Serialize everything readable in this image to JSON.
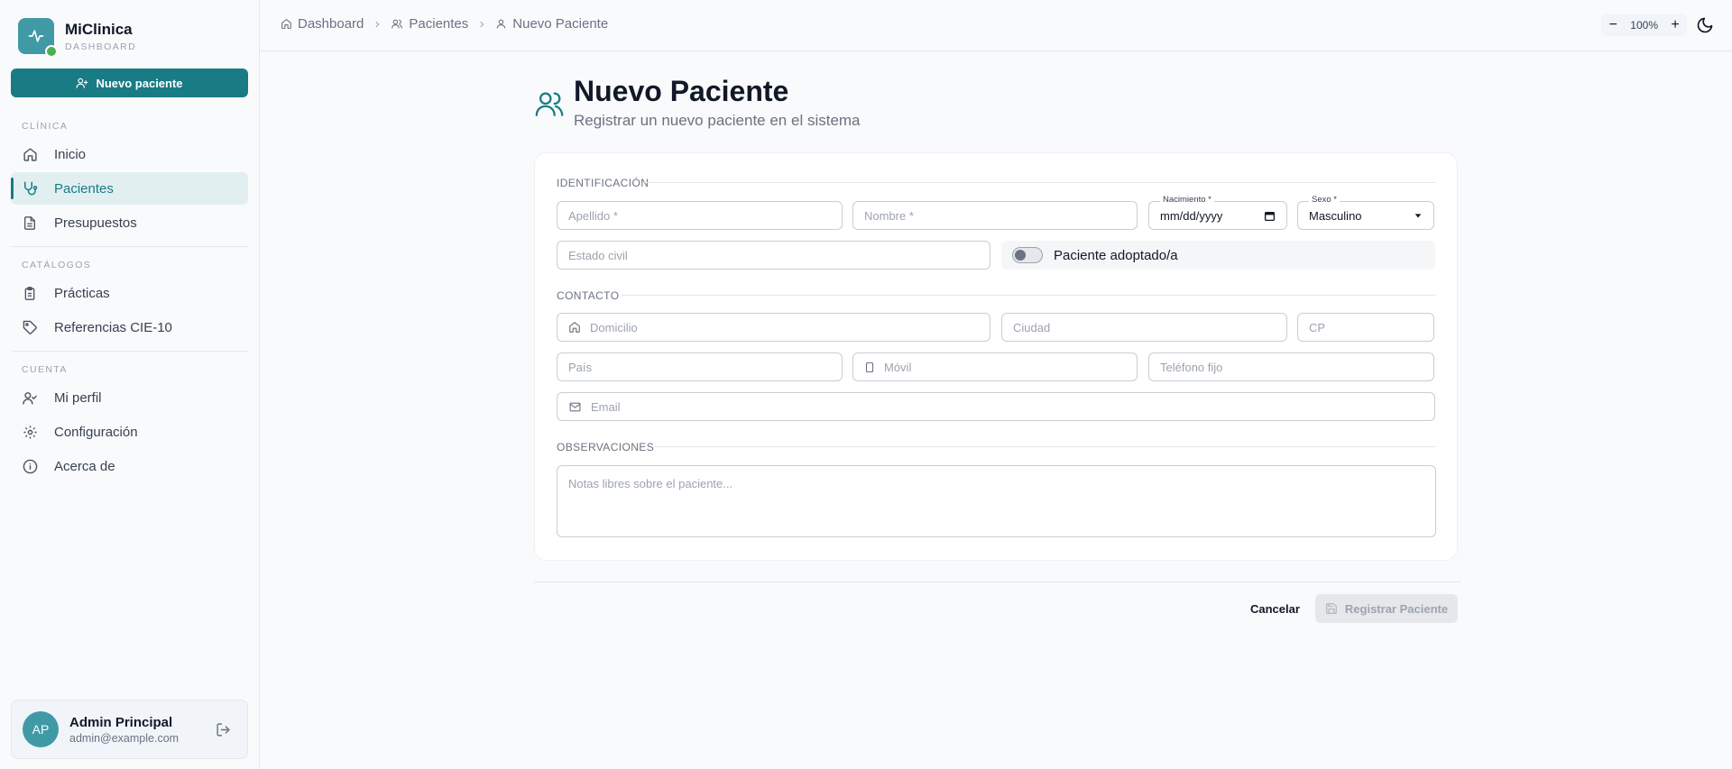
{
  "brand": {
    "name": "MiClinica",
    "subtitle": "DASHBOARD"
  },
  "sidebar": {
    "new_button": "Nuevo paciente",
    "sections": {
      "clinica": "CLÍNICA",
      "catalogos": "CATÁLOGOS",
      "cuenta": "CUENTA"
    },
    "items": {
      "inicio": "Inicio",
      "pacientes": "Pacientes",
      "presupuestos": "Presupuestos",
      "practicas": "Prácticas",
      "referencias": "Referencias CIE-10",
      "perfil": "Mi perfil",
      "configuracion": "Configuración",
      "acerca": "Acerca de"
    },
    "active_item": "pacientes",
    "user": {
      "initials": "AP",
      "name": "Admin Principal",
      "email": "admin@example.com"
    }
  },
  "header": {
    "breadcrumb": [
      "Dashboard",
      "Pacientes",
      "Nuevo Paciente"
    ],
    "zoom": "100%",
    "zoom_minus": "−",
    "zoom_plus": "+"
  },
  "page": {
    "title": "Nuevo Paciente",
    "subtitle": "Registrar un nuevo paciente en el sistema"
  },
  "form": {
    "sections": {
      "identificacion": "IDENTIFICACIÓN",
      "contacto": "CONTACTO",
      "observaciones": "OBSERVACIONES"
    },
    "apellido_placeholder": "Apellido *",
    "nombre_placeholder": "Nombre *",
    "nacimiento_label": "Nacimiento *",
    "nacimiento_value": "mm/dd/yyyy",
    "sexo_label": "Sexo *",
    "sexo_value": "Masculino",
    "estado_civil_placeholder": "Estado civil",
    "adoptado_label": "Paciente adoptado/a",
    "adoptado_on": false,
    "domicilio_placeholder": "Domicilio",
    "ciudad_placeholder": "Ciudad",
    "cp_placeholder": "CP",
    "pais_placeholder": "País",
    "movil_placeholder": "Móvil",
    "telefono_placeholder": "Teléfono fijo",
    "email_placeholder": "Email",
    "notas_placeholder": "Notas libres sobre el paciente..."
  },
  "actions": {
    "cancel": "Cancelar",
    "submit": "Registrar Paciente"
  },
  "colors": {
    "accent": "#197b84",
    "brand": "#3f9aa5",
    "online": "#4caf50"
  }
}
